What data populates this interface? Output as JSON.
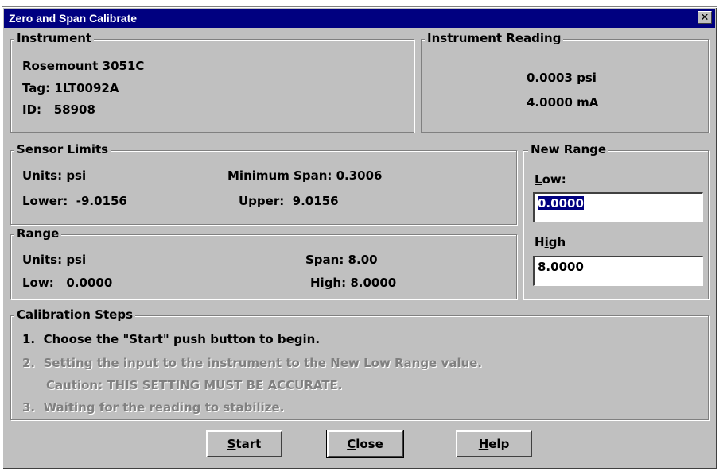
{
  "window": {
    "title": "Zero and Span Calibrate",
    "close_glyph": "✕"
  },
  "instrument": {
    "label": "Instrument",
    "model": "Rosemount 3051C",
    "tag": "Tag: 1LT0092A",
    "id": "ID:   58908"
  },
  "reading": {
    "label": "Instrument Reading",
    "pressure": "0.0003 psi",
    "current": "4.0000 mA"
  },
  "sensor_limits": {
    "label": "Sensor Limits",
    "units": "Units: psi",
    "min_span": "Minimum Span: 0.3006",
    "lower": "Lower:  -9.0156",
    "upper": "Upper:  9.0156"
  },
  "range": {
    "label": "Range",
    "units": "Units: psi",
    "span": "Span: 8.00",
    "low": "Low:   0.0000",
    "high": "High: 8.0000"
  },
  "new_range": {
    "label": "New Range",
    "low_label_mnemonic": "L",
    "low_label_rest": "ow:",
    "low_value": "0.0000",
    "high_label_pre": "H",
    "high_label_mnemonic": "i",
    "high_label_rest": "gh",
    "high_value": "8.0000"
  },
  "calibration_steps": {
    "label": "Calibration Steps",
    "step1": "1.  Choose the \"Start\" push button to begin.",
    "step2": "2.  Setting the input to the instrument to the New Low Range value.",
    "caution": "Caution: THIS SETTING MUST BE ACCURATE.",
    "step3": "3.  Waiting for the reading to stabilize."
  },
  "buttons": {
    "start_mnemonic": "S",
    "start_rest": "tart",
    "close_mnemonic": "C",
    "close_rest": "lose",
    "help_mnemonic": "H",
    "help_rest": "elp"
  }
}
